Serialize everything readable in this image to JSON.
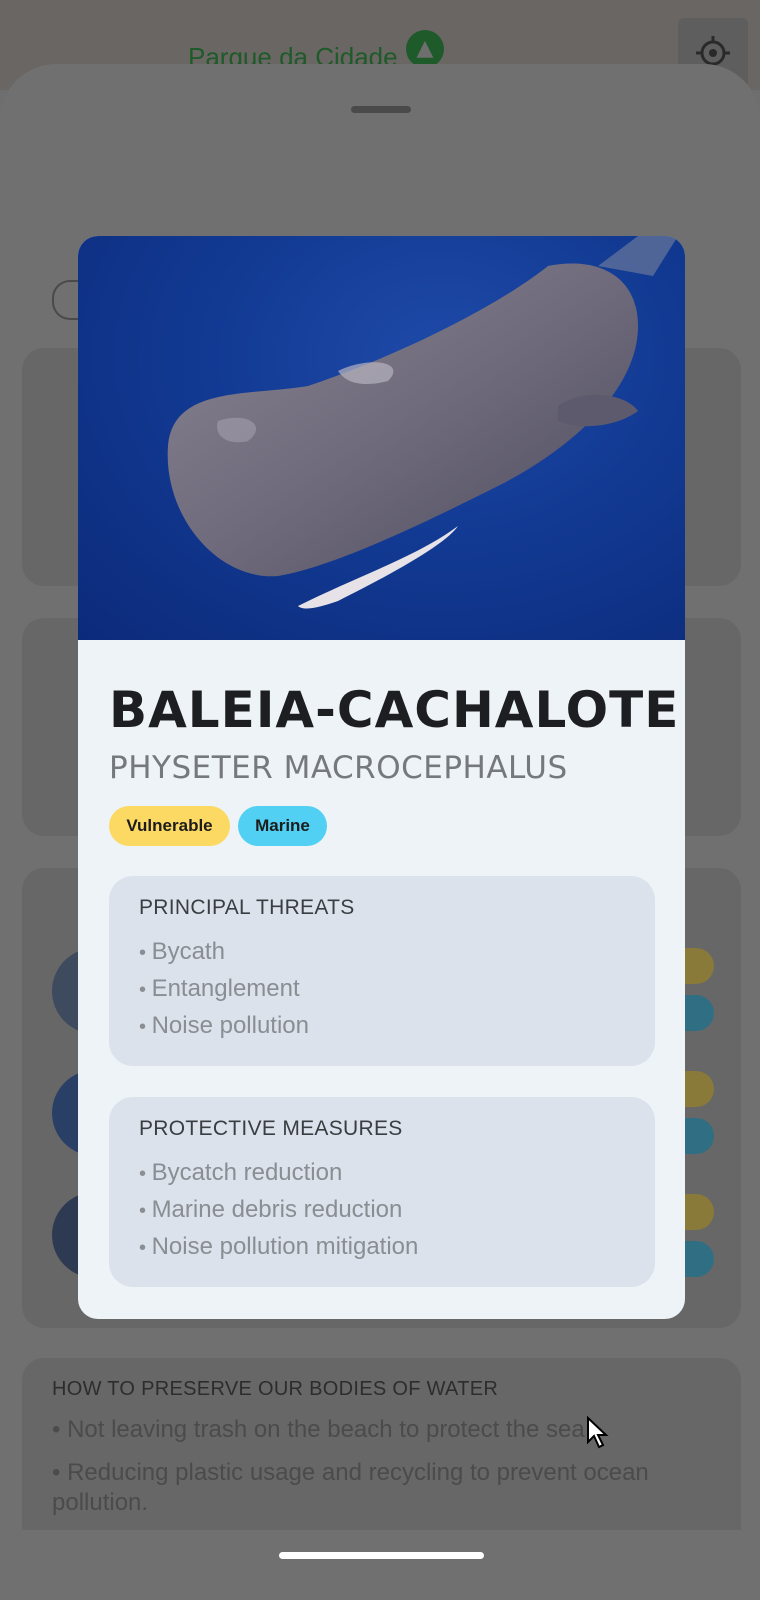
{
  "background": {
    "park_title": "Parque da Cidade",
    "park_icon": "tree-icon",
    "locate_icon": "crosshair-icon",
    "preserve": {
      "title": "HOW TO PRESERVE OUR BODIES OF WATER",
      "items": [
        "• Not leaving trash on the beach to protect the sea.",
        "• Reducing plastic usage and recycling to prevent ocean pollution."
      ]
    }
  },
  "modal": {
    "image": "sperm-whale-photo",
    "name": "BALEIA-CACHALOTE",
    "scientific_name": "PHYSETER MACROCEPHALUS",
    "status": "Vulnerable",
    "habitat": "Marine",
    "threats": {
      "title": "PRINCIPAL THREATS",
      "items": [
        "Bycath",
        "Entanglement",
        "Noise pollution"
      ]
    },
    "measures": {
      "title": "PROTECTIVE MEASURES",
      "items": [
        "Bycatch reduction",
        "Marine debris reduction",
        "Noise pollution mitigation"
      ]
    }
  },
  "colors": {
    "status_chip": "#fcd963",
    "habitat_chip": "#51d0f4",
    "card_bg": "#eef3f7",
    "info_box_bg": "#dbe2eb"
  }
}
